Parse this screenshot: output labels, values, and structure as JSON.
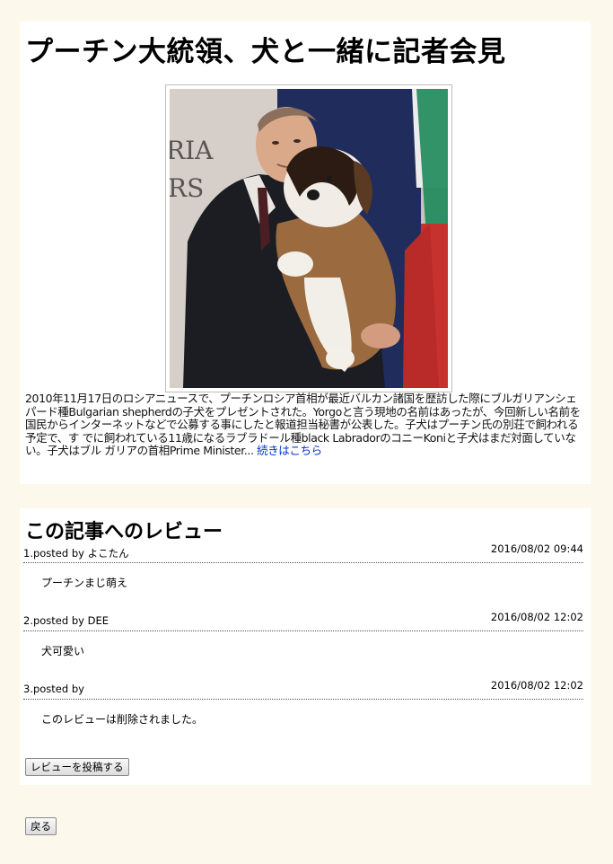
{
  "article": {
    "title": "プーチン大統領、犬と一緒に記者会見",
    "image_alt": "プーチン大統領が子犬を抱いている写真",
    "body_text": "2010年11月17日のロシアニュースで、プーチンロシア首相が最近バルカン諸国を歴訪した際にブルガリアンシェパード種Bulgarian shepherdの子犬をプレゼントされた。Yorgoと言う現地の名前はあったが、今回新しい名前を国民からインターネットなどで公募する事にしたと報道担当秘書が公表した。子犬はプーチン氏の別荘で飼われる予定で、す でに飼われている11歳になるラブラドール種black LabradorのコニーKoniと子犬はまだ対面していない。子犬はブル ガリアの首相Prime Minister... ",
    "read_more_link": "続きはこちら"
  },
  "reviews": {
    "heading": "この記事へのレビュー",
    "items": [
      {
        "poster": "1.posted by よこたん",
        "date": "2016/08/02 09:44",
        "text": "プーチンまじ萌え"
      },
      {
        "poster": "2.posted by DEE",
        "date": "2016/08/02 12:02",
        "text": "犬可愛い"
      },
      {
        "poster": "3.posted by",
        "date": "2016/08/02 12:02",
        "text": "このレビューは削除されました。"
      }
    ],
    "post_button": "レビューを投稿する"
  },
  "back_button": "戻る",
  "colors": {
    "page_background": "#fdf8ec",
    "card_background": "#ffffff",
    "link": "#0033cc"
  }
}
